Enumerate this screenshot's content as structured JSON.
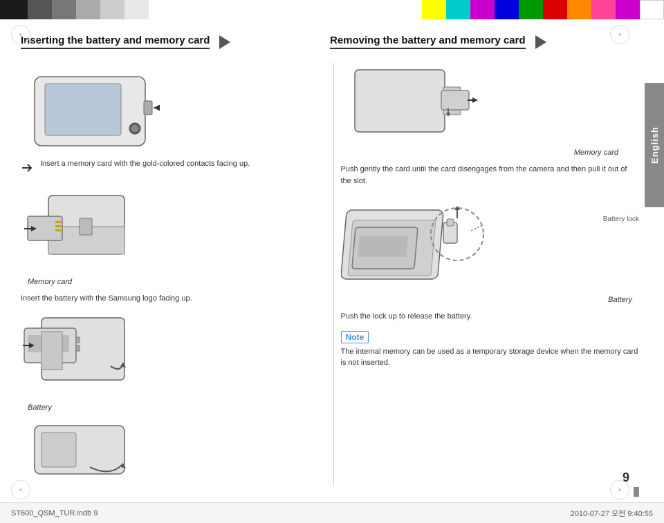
{
  "topBar": {
    "colors": [
      "#1a1a1a",
      "#555555",
      "#888888",
      "#aaaaaa",
      "#cccccc",
      "#eeeeee",
      "#ffffff",
      "#ffff00",
      "#00ffff",
      "#ff00ff",
      "#0000ff",
      "#00aa00",
      "#ff0000",
      "#ff8800",
      "#ff4488",
      "#cc00cc",
      "#ffffff"
    ]
  },
  "header": {
    "left_title": "Inserting the battery and memory card",
    "right_title": "Removing the battery and memory card",
    "side_tab": "English"
  },
  "left_section": {
    "instr1": "Insert a memory card with the gold-colored contacts facing up.",
    "instr2": "Insert the battery with the Samsung logo facing up.",
    "memory_card_label": "Memory card",
    "battery_label": "Battery"
  },
  "right_section": {
    "memory_card_desc": "Push gently the card until the card disengages from the camera and then pull it out of the slot.",
    "memory_card_label": "Memory card",
    "battery_lock_label": "Battery lock",
    "battery_desc": "Push the lock up to release the battery.",
    "battery_label": "Battery",
    "note_label": "Note",
    "note_text": "The internal memory can be used as a temporary storage device when the memory card is not inserted."
  },
  "footer": {
    "left": "ST600_QSM_TUR.indb   9",
    "right": "2010-07-27   오전 9:40:55"
  },
  "page_number": "9"
}
